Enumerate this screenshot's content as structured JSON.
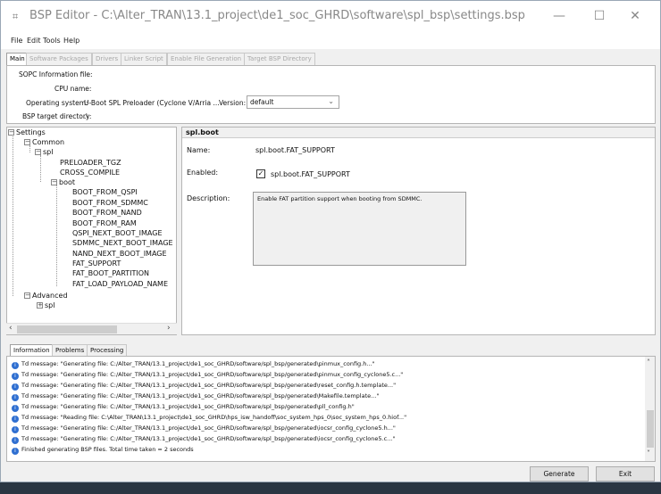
{
  "window": {
    "icon_glyph": "⌗",
    "title": "BSP Editor - C:\\Alter_TRAN\\13.1_project\\de1_soc_GHRD\\software\\spl_bsp\\settings.bsp",
    "minimize": "—",
    "maximize": "☐",
    "close": "✕"
  },
  "menu": [
    "File",
    "Edit",
    "Tools",
    "Help"
  ],
  "top_tabs": [
    "Main",
    "Software Packages",
    "Drivers",
    "Linker Script",
    "Enable File Generation",
    "Target BSP Directory"
  ],
  "info": {
    "sopc_label": "SOPC Information file:",
    "cpu_label": "CPU name:",
    "os_label": "Operating system:",
    "os_value": "U-Boot SPL Preloader (Cyclone V/Arria ...",
    "version_label": "Version:",
    "version_value": "default",
    "bsp_dir_label": "BSP target directory:",
    "bsp_dir_value": ".\\"
  },
  "tree": {
    "root": "Settings",
    "common": "Common",
    "spl": "spl",
    "preloader": "PRELOADER_TGZ",
    "cross": "CROSS_COMPILE",
    "boot": "boot",
    "boot_items": [
      "BOOT_FROM_QSPI",
      "BOOT_FROM_SDMMC",
      "BOOT_FROM_NAND",
      "BOOT_FROM_RAM",
      "QSPI_NEXT_BOOT_IMAGE",
      "SDMMC_NEXT_BOOT_IMAGE",
      "NAND_NEXT_BOOT_IMAGE",
      "FAT_SUPPORT",
      "FAT_BOOT_PARTITION",
      "FAT_LOAD_PAYLOAD_NAME"
    ],
    "advanced": "Advanced",
    "adv_spl": "spl"
  },
  "detail": {
    "header": "spl.boot",
    "name_label": "Name:",
    "name_value": "spl.boot.FAT_SUPPORT",
    "enabled_label": "Enabled:",
    "enabled_checked": true,
    "enabled_value": "spl.boot.FAT_SUPPORT",
    "description_label": "Description:",
    "description_value": "Enable FAT partition support when booting from SDMMC."
  },
  "log_tabs": [
    "Information",
    "Problems",
    "Processing"
  ],
  "log_lines": [
    "Td message: \"Generating file: C:/Alter_TRAN/13.1_project/de1_soc_GHRD/software/spl_bsp/generated\\pinmux_config.h...\"",
    "Td message: \"Generating file: C:/Alter_TRAN/13.1_project/de1_soc_GHRD/software/spl_bsp/generated\\pinmux_config_cyclone5.c...\"",
    "Td message: \"Generating file: C:/Alter_TRAN/13.1_project/de1_soc_GHRD/software/spl_bsp/generated\\reset_config.h.template...\"",
    "Td message: \"Generating file: C:/Alter_TRAN/13.1_project/de1_soc_GHRD/software/spl_bsp/generated\\Makefile.template...\"",
    "Td message: \"Generating file: C:/Alter_TRAN/13.1_project/de1_soc_GHRD/software/spl_bsp/generated\\pll_config.h\"",
    "Td message: \"Reading file: C:\\Alter_TRAN\\13.1_project\\de1_soc_GHRD\\hps_isw_handoff\\soc_system_hps_0\\soc_system_hps_0.hiof...\"",
    "Td message: \"Generating file: C:/Alter_TRAN/13.1_project/de1_soc_GHRD/software/spl_bsp/generated\\iocsr_config_cyclone5.h...\"",
    "Td message: \"Generating file: C:/Alter_TRAN/13.1_project/de1_soc_GHRD/software/spl_bsp/generated\\iocsr_config_cyclone5.c...\"",
    "Finished generating BSP files. Total time taken = 2 seconds"
  ],
  "buttons": {
    "generate": "Generate",
    "exit": "Exit"
  },
  "colors": {
    "info_icon": "#2f6fd1",
    "window_bg": "#f0f0f0"
  }
}
